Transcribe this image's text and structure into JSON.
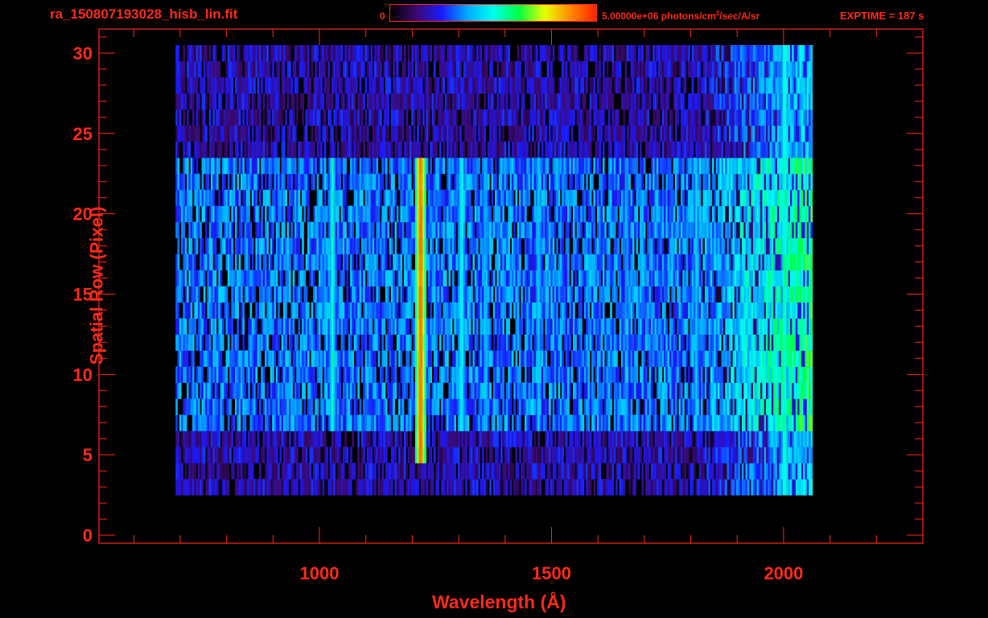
{
  "header": {
    "filename": "ra_150807193028_hisb_lin.fit",
    "colorbar_min_label": "0",
    "colorbar_max_value": "5.00000e+06",
    "colorbar_units_pre": "photons/cm",
    "colorbar_units_sup": "2",
    "colorbar_units_post": "/sec/A/sr",
    "exptime_label": "EXPTIME = 187 s"
  },
  "colors": {
    "axis": "#ff2a1a",
    "background": "#000000",
    "colormap": [
      "#000000",
      "#3b0a6e",
      "#1a1aff",
      "#00aaff",
      "#00ffee",
      "#00ff44",
      "#e8ff00",
      "#ff8a00",
      "#ff2200"
    ]
  },
  "chart_data": {
    "type": "heatmap",
    "title": "ra_150807193028_hisb_lin.fit",
    "xlabel": "Wavelength (Å)",
    "ylabel": "Spatial Row (Pixel)",
    "xlim": [
      525,
      2300
    ],
    "ylim": [
      -0.5,
      31.5
    ],
    "x_ticks": [
      1000,
      1500,
      2000
    ],
    "y_ticks": [
      0,
      5,
      10,
      15,
      20,
      25,
      30
    ],
    "x_minor_step": 100,
    "y_minor_step": 1,
    "value_range": [
      0,
      5000000
    ],
    "data_x_range": [
      690,
      2060
    ],
    "data_rows_range": [
      3,
      30
    ],
    "features": [
      {
        "wavelength": 1216,
        "rows": [
          5,
          23
        ],
        "level": 0.95
      },
      {
        "wavelength": 1026,
        "rows": [
          7,
          23
        ],
        "level": 0.5
      },
      {
        "wavelength": 1304,
        "rows": [
          7,
          23
        ],
        "level": 0.5
      },
      {
        "wavelength": 1356,
        "rows": [
          7,
          23
        ],
        "level": 0.4
      },
      {
        "wavelength": 1470,
        "rows": [
          7,
          23
        ],
        "level": 0.4
      },
      {
        "wavelength": 1660,
        "rows": [
          7,
          23
        ],
        "level": 0.35
      },
      {
        "wavelength": 1810,
        "rows": [
          7,
          23
        ],
        "level": 0.4
      },
      {
        "wavelength": 2000,
        "rows": [
          3,
          30
        ],
        "level": 0.55
      }
    ],
    "grid": false
  }
}
